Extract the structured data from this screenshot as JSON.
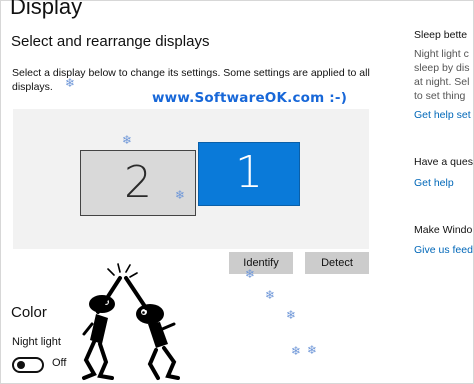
{
  "page": {
    "title": "Display",
    "section_title": "Select and rearrange displays",
    "description": "Select a display below to change its settings. Some settings are applied to all displays.",
    "watermark": "www.SoftwareOK.com :-)"
  },
  "displays": [
    {
      "label": "2",
      "selected": false
    },
    {
      "label": "1",
      "selected": true
    }
  ],
  "buttons": {
    "identify": "Identify",
    "detect": "Detect"
  },
  "color_section": {
    "title": "Color",
    "night_light_label": "Night light",
    "night_light_state": "Off"
  },
  "sidebar": {
    "sleep_heading": "Sleep bette",
    "sleep_lines": [
      "Night light c",
      "sleep by dis",
      "at night. Sel",
      "to set thing"
    ],
    "get_help_settings": "Get help set",
    "question_heading": "Have a ques",
    "get_help": "Get help",
    "make_windows": "Make Windo",
    "give_feedback": "Give us feed"
  },
  "colors": {
    "accent": "#0a7ad9",
    "link": "#0067b8",
    "watermark": "#1767d8",
    "panel_bg": "#f2f2f2",
    "button_bg": "#cccccc"
  },
  "icons": [
    "snowflake-icon",
    "dancing-figures-icon"
  ]
}
